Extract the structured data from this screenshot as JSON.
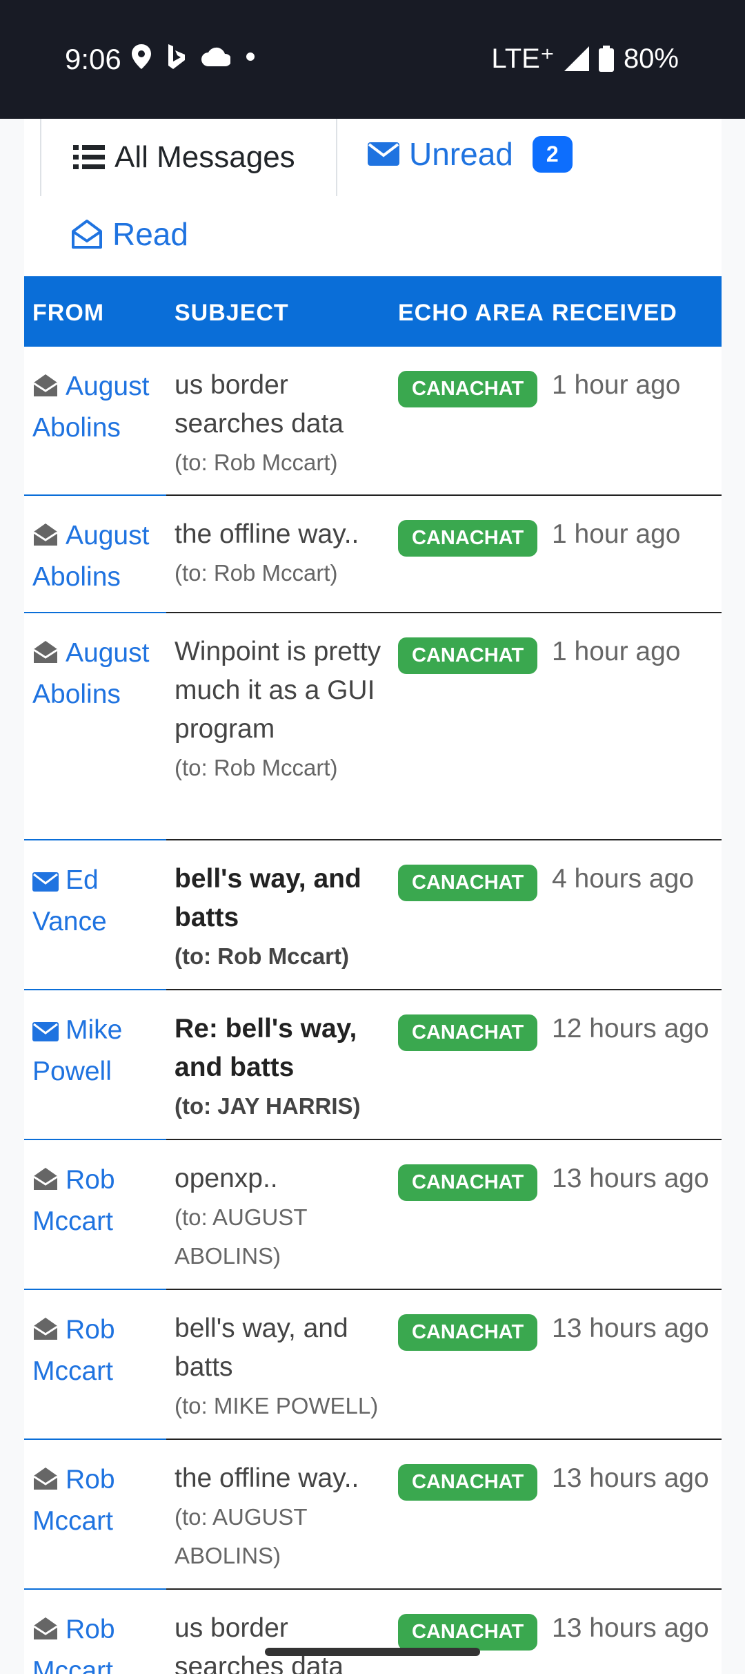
{
  "status_bar": {
    "time": "9:06",
    "network": "LTE⁺",
    "battery": "80%"
  },
  "tabs": {
    "all": "All Messages",
    "unread": "Unread",
    "unread_count": "2",
    "read": "Read"
  },
  "table": {
    "headers": [
      "FROM",
      "SUBJECT",
      "ECHO AREA",
      "RECEIVED"
    ],
    "rows": [
      {
        "from": "August Abolins",
        "subject": "us border searches data",
        "to": "(to: Rob Mccart)",
        "echo": "CANACHAT",
        "received": "1 hour ago",
        "unread": false
      },
      {
        "from": "August Abolins",
        "subject": "the offline way..",
        "to": "(to: Rob Mccart)",
        "echo": "CANACHAT",
        "received": "1 hour ago",
        "unread": false
      },
      {
        "from": "August Abolins",
        "subject": "Winpoint is pretty much it as a GUI program",
        "to": "(to: Rob Mccart)",
        "echo": "CANACHAT",
        "received": "1 hour ago",
        "unread": false
      },
      {
        "from": "Ed Vance",
        "subject": "bell's way, and batts",
        "to": "(to: Rob Mccart)",
        "echo": "CANACHAT",
        "received": "4 hours ago",
        "unread": true
      },
      {
        "from": "Mike Powell",
        "subject": "Re: bell's way, and batts",
        "to": "(to: JAY HARRIS)",
        "echo": "CANACHAT",
        "received": "12 hours ago",
        "unread": true
      },
      {
        "from": "Rob Mccart",
        "subject": "openxp..",
        "to": "(to: AUGUST ABOLINS)",
        "echo": "CANACHAT",
        "received": "13 hours ago",
        "unread": false
      },
      {
        "from": "Rob Mccart",
        "subject": "bell's way, and batts",
        "to": "(to: MIKE POWELL)",
        "echo": "CANACHAT",
        "received": "13 hours ago",
        "unread": false
      },
      {
        "from": "Rob Mccart",
        "subject": "the offline way..",
        "to": "(to: AUGUST ABOLINS)",
        "echo": "CANACHAT",
        "received": "13 hours ago",
        "unread": false
      },
      {
        "from": "Rob Mccart",
        "subject": "us border searches data",
        "to": "",
        "echo": "CANACHAT",
        "received": "13 hours ago",
        "unread": false
      }
    ]
  },
  "colors": {
    "header_bg": "#0a6ed8",
    "link": "#1f73e0",
    "echo_badge": "#3aa84f",
    "unread_badge": "#0d6efd"
  }
}
